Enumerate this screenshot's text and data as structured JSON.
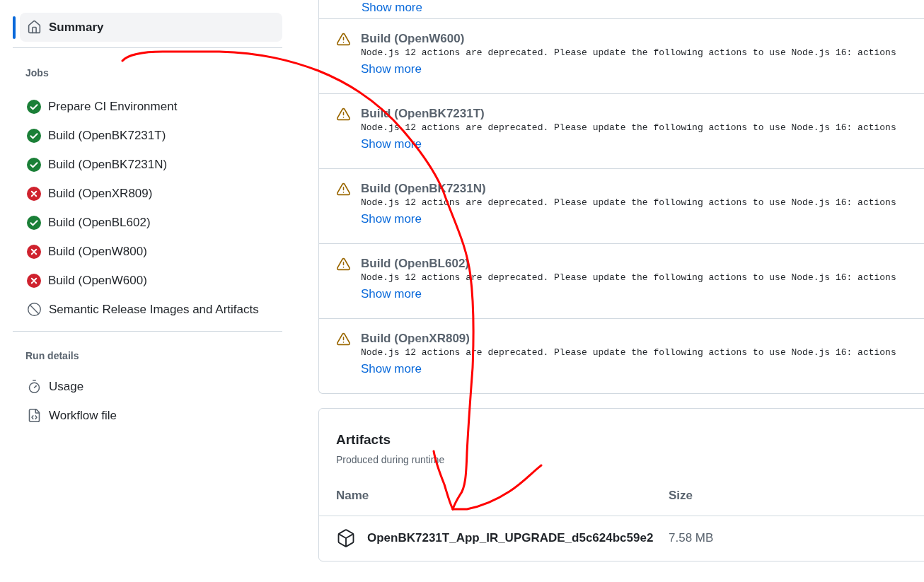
{
  "sidebar": {
    "summary": {
      "label": "Summary",
      "selected": true
    },
    "jobs_heading": "Jobs",
    "jobs": [
      {
        "label": "Prepare CI Environment",
        "kind": "success"
      },
      {
        "label": "Build (OpenBK7231T)",
        "kind": "success"
      },
      {
        "label": "Build (OpenBK7231N)",
        "kind": "success"
      },
      {
        "label": "Build (OpenXR809)",
        "kind": "failure"
      },
      {
        "label": "Build (OpenBL602)",
        "kind": "success"
      },
      {
        "label": "Build (OpenW800)",
        "kind": "failure"
      },
      {
        "label": "Build (OpenW600)",
        "kind": "failure"
      },
      {
        "label": "Semantic Release Images and Artifacts",
        "kind": "skipped"
      }
    ],
    "run_details_heading": "Run details",
    "run_details": [
      {
        "label": "Usage",
        "kind": "usage"
      },
      {
        "label": "Workflow file",
        "kind": "workflow"
      }
    ]
  },
  "annotations": {
    "top_link": "Show more",
    "items": [
      {
        "title": "Build (OpenW600)",
        "message": "Node.js 12 actions are deprecated. Please update the following actions to use Node.js 16: actions",
        "link": "Show more"
      },
      {
        "title": "Build (OpenBK7231T)",
        "message": "Node.js 12 actions are deprecated. Please update the following actions to use Node.js 16: actions",
        "link": "Show more"
      },
      {
        "title": "Build (OpenBK7231N)",
        "message": "Node.js 12 actions are deprecated. Please update the following actions to use Node.js 16: actions",
        "link": "Show more"
      },
      {
        "title": "Build (OpenBL602)",
        "message": "Node.js 12 actions are deprecated. Please update the following actions to use Node.js 16: actions",
        "link": "Show more"
      },
      {
        "title": "Build (OpenXR809)",
        "message": "Node.js 12 actions are deprecated. Please update the following actions to use Node.js 16: actions",
        "link": "Show more"
      }
    ]
  },
  "artifacts": {
    "title": "Artifacts",
    "subtitle": "Produced during runtime",
    "columns": [
      "Name",
      "Size"
    ],
    "rows": [
      {
        "name": "OpenBK7231T_App_IR_UPGRADE_d5c624bc59e2",
        "size": "7.58 MB"
      }
    ]
  }
}
